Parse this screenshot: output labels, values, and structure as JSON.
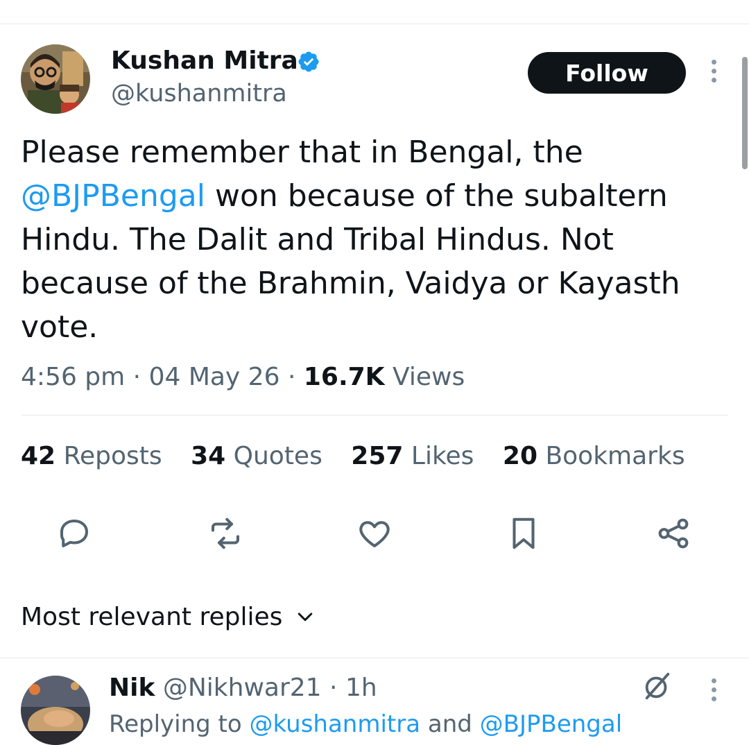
{
  "tweet": {
    "author": {
      "display_name": "Kushan Mitra",
      "handle": "@kushanmitra",
      "verified": true,
      "avatar_icon": "avatar-cartoon"
    },
    "follow_label": "Follow",
    "more_icon": "more-vertical-icon",
    "text_before": "Please remember that in Bengal, the ",
    "mention": "@BJPBengal",
    "text_after": " won because of the subaltern Hindu. The Dalit and Tribal Hindus. Not because of the Brahmin, Vaidya or Kayasth vote.",
    "time": "4:56 pm",
    "date": "04 May 26",
    "views_count": "16.7K",
    "views_label": "Views",
    "separator": " · "
  },
  "stats": {
    "reposts": {
      "count": "42",
      "label": "Reposts"
    },
    "quotes": {
      "count": "34",
      "label": "Quotes"
    },
    "likes": {
      "count": "257",
      "label": "Likes"
    },
    "bookmarks": {
      "count": "20",
      "label": "Bookmarks"
    }
  },
  "actions": [
    "reply-icon",
    "repost-icon",
    "like-icon",
    "bookmark-icon",
    "share-icon"
  ],
  "replies": {
    "sort_label": "Most relevant replies"
  },
  "reply": {
    "name": "Nik",
    "handle": "@Nikhwar21",
    "time": "1h",
    "replying_prefix": "Replying to ",
    "replying_to_1": "@kushanmitra",
    "replying_joiner": " and ",
    "replying_to_2": "@BJPBengal"
  },
  "colors": {
    "accent": "#1d9bf0",
    "text": "#0f1419",
    "secondary": "#536471",
    "button": "#0f1419"
  }
}
